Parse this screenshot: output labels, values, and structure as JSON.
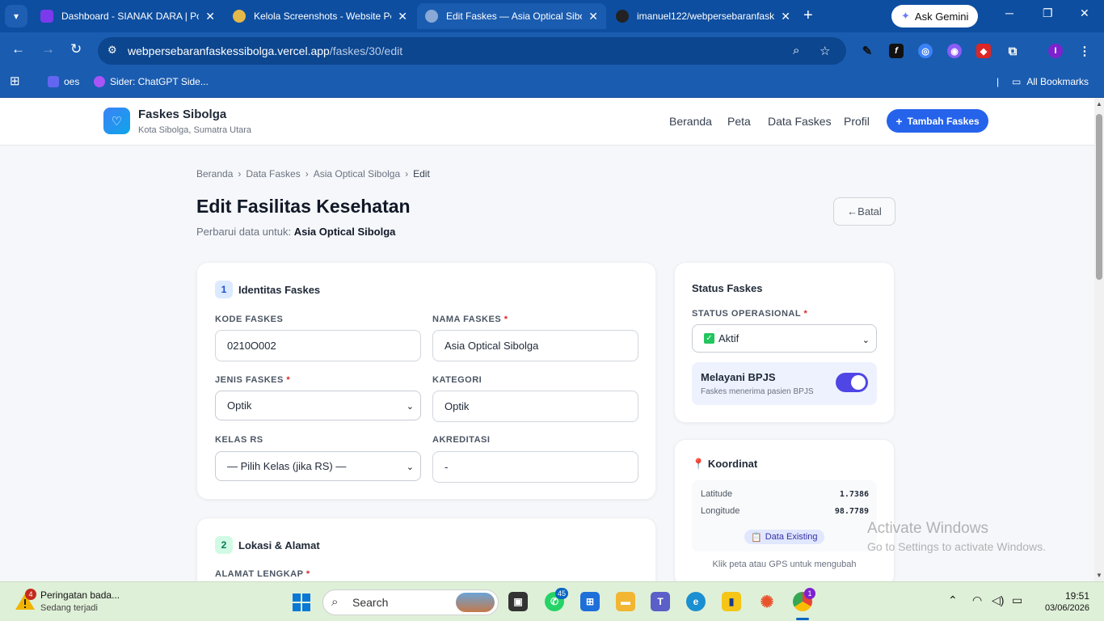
{
  "browser": {
    "tabs": [
      {
        "title": "Dashboard - SIANAK DARA | Po",
        "active": false
      },
      {
        "title": "Kelola Screenshots - Website Pe",
        "active": false
      },
      {
        "title": "Edit Faskes — Asia Optical Sibol",
        "active": true
      },
      {
        "title": "imanuel122/webpersebaranfask",
        "active": false
      }
    ],
    "gemini_label": "Ask Gemini",
    "url_host": "webpersebaranfaskessibolga.vercel.app",
    "url_path": "/faskes/30/edit",
    "profile_initial": "I",
    "bookmarks": [
      {
        "label": "oes"
      },
      {
        "label": "Sider: ChatGPT Side..."
      }
    ],
    "all_bookmarks": "All Bookmarks"
  },
  "site": {
    "brand": "Faskes Sibolga",
    "brand_sub": "Kota Sibolga, Sumatra Utara",
    "nav": [
      "Beranda",
      "Peta",
      "Data Faskes",
      "Profil"
    ],
    "add_button": "Tambah Faskes"
  },
  "breadcrumb": {
    "items": [
      "Beranda",
      "Data Faskes",
      "Asia Optical Sibolga"
    ],
    "sep": "›",
    "current": "Edit"
  },
  "page": {
    "title": "Edit Fasilitas Kesehatan",
    "subtitle_prefix": "Perbarui data untuk:",
    "subtitle_name": "Asia Optical Sibolga",
    "cancel_label": "Batal"
  },
  "identity": {
    "number": "1",
    "title": "Identitas Faskes",
    "kode_label": "KODE FASKES",
    "kode_value": "0210O002",
    "nama_label": "NAMA FASKES",
    "nama_value": "Asia Optical Sibolga",
    "jenis_label": "JENIS FASKES",
    "jenis_value": "Optik",
    "kategori_label": "KATEGORI",
    "kategori_value": "Optik",
    "kelas_label": "KELAS RS",
    "kelas_value": "— Pilih Kelas (jika RS) —",
    "akreditasi_label": "AKREDITASI",
    "akreditasi_value": "-"
  },
  "location": {
    "number": "2",
    "title": "Lokasi & Alamat",
    "alamat_label": "ALAMAT LENGKAP"
  },
  "status": {
    "title": "Status Faskes",
    "operasional_label": "STATUS OPERASIONAL",
    "operasional_value": "Aktif",
    "bpjs_title": "Melayani BPJS",
    "bpjs_sub": "Faskes menerima pasien BPJS",
    "bpjs_on": true
  },
  "coordinates": {
    "title": "Koordinat",
    "lat_label": "Latitude",
    "lat_value": "1.7386",
    "lng_label": "Longitude",
    "lng_value": "98.7789",
    "badge": "Data Existing",
    "hint": "Klik peta atau GPS untuk mengubah"
  },
  "watermark": {
    "line1": "Activate Windows",
    "line2": "Go to Settings to activate Windows."
  },
  "taskbar": {
    "notif_count": "4",
    "notif_title": "Peringatan bada...",
    "notif_sub": "Sedang terjadi",
    "search_placeholder": "Search",
    "whatsapp_badge": "45",
    "chrome_badge": "1",
    "time": "19:51",
    "date": "03/06/2026"
  },
  "colors": {
    "chrome_blue": "#1a5cb0",
    "primary": "#2563eb",
    "toggle": "#4f46e5"
  }
}
